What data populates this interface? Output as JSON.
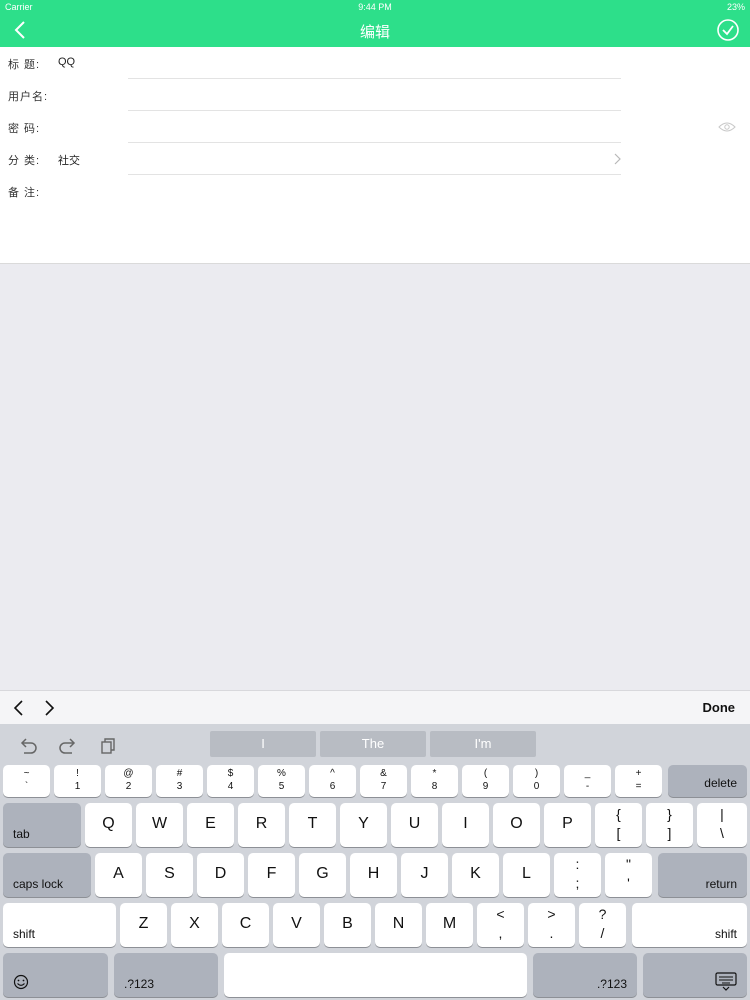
{
  "status": {
    "carrier": "Carrier",
    "time": "9:44 PM",
    "battery": "23%"
  },
  "nav": {
    "title": "编辑"
  },
  "form": [
    {
      "label": "标  题:",
      "value": "QQ"
    },
    {
      "label": "用户名:",
      "value": ""
    },
    {
      "label": "密  码:",
      "value": ""
    },
    {
      "label": "分  类:",
      "value": "社交"
    },
    {
      "label": "备  注:",
      "value": ""
    }
  ],
  "accessory": {
    "done": "Done"
  },
  "keyboard": {
    "suggestions": [
      "I",
      "The",
      "I'm"
    ],
    "number_row": [
      {
        "top": "~",
        "bottom": "`"
      },
      {
        "top": "!",
        "bottom": "1"
      },
      {
        "top": "@",
        "bottom": "2"
      },
      {
        "top": "#",
        "bottom": "3"
      },
      {
        "top": "$",
        "bottom": "4"
      },
      {
        "top": "%",
        "bottom": "5"
      },
      {
        "top": "^",
        "bottom": "6"
      },
      {
        "top": "&",
        "bottom": "7"
      },
      {
        "top": "*",
        "bottom": "8"
      },
      {
        "top": "(",
        "bottom": "9"
      },
      {
        "top": ")",
        "bottom": "0"
      },
      {
        "top": "_",
        "bottom": "-"
      },
      {
        "top": "+",
        "bottom": "="
      }
    ],
    "delete": "delete",
    "tab": "tab",
    "row1": [
      "Q",
      "W",
      "E",
      "R",
      "T",
      "Y",
      "U",
      "I",
      "O",
      "P"
    ],
    "row1_symbols": [
      {
        "top": "{",
        "bottom": "["
      },
      {
        "top": "}",
        "bottom": "]"
      },
      {
        "top": "|",
        "bottom": "\\"
      }
    ],
    "caps": "caps lock",
    "row2": [
      "A",
      "S",
      "D",
      "F",
      "G",
      "H",
      "J",
      "K",
      "L"
    ],
    "row2_symbols": [
      {
        "top": ":",
        "bottom": ";"
      },
      {
        "top": "\"",
        "bottom": "'"
      }
    ],
    "return": "return",
    "shift": "shift",
    "row3": [
      "Z",
      "X",
      "C",
      "V",
      "B",
      "N",
      "M"
    ],
    "row3_symbols": [
      {
        "top": "<",
        "bottom": ","
      },
      {
        "top": ">",
        "bottom": "."
      },
      {
        "top": "?",
        "bottom": "/"
      }
    ],
    "numbers": ".?123"
  }
}
